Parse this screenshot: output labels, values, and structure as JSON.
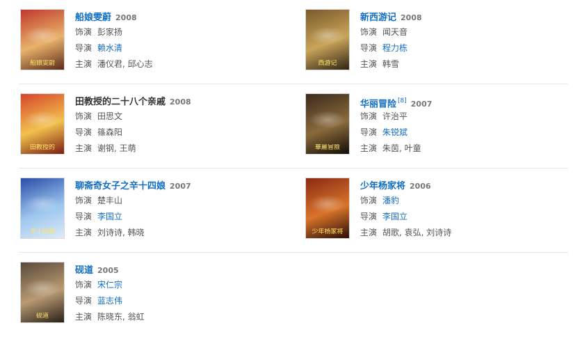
{
  "labels": {
    "role": "饰演",
    "director": "导演",
    "starring": "主演"
  },
  "films": [
    {
      "title": "船娘雯蔚",
      "year": "2008",
      "role": "彭家扬",
      "director": "赖水清",
      "starring": "潘仪君, 邱心志",
      "poster_caption": "船娘雯蔚",
      "colors": [
        "#c0392b",
        "#e8b26a",
        "#5a2a1a"
      ]
    },
    {
      "title": "新西游记",
      "year": "2008",
      "role": "闻天音",
      "director": "程力栋",
      "starring": "韩雪",
      "poster_caption": "西游记",
      "colors": [
        "#7a5a2a",
        "#c9a45a",
        "#2e2313"
      ]
    },
    {
      "title": "田教授的二十八个亲戚",
      "year": "2008",
      "role": "田思文",
      "director": "篠森阳",
      "starring": "谢钢, 王萌",
      "poster_caption": "田教授的",
      "colors": [
        "#d6452a",
        "#f2c14e",
        "#7a1f12"
      ]
    },
    {
      "title": "华丽冒险",
      "sup": "[8]",
      "year": "2007",
      "role": "许治平",
      "director": "朱锐斌",
      "starring": "朱茵, 叶童",
      "poster_caption": "華麗冒險",
      "colors": [
        "#3a2a1c",
        "#8a6a3c",
        "#120c08"
      ]
    },
    {
      "title": "聊斋奇女子之辛十四娘",
      "year": "2007",
      "role": "楚丰山",
      "director": "李国立",
      "starring": "刘诗诗, 韩晓",
      "poster_caption": "辛十四娘",
      "colors": [
        "#2a4ea8",
        "#9cc6ef",
        "#dfeaf6"
      ]
    },
    {
      "title": "少年杨家将",
      "year": "2006",
      "role": "潘豹",
      "director": "李国立",
      "starring": "胡歌, 袁弘, 刘诗诗",
      "poster_caption": "少年杨家将",
      "colors": [
        "#8a2a14",
        "#d9742a",
        "#2a0e06"
      ]
    },
    {
      "title": "砚道",
      "year": "2005",
      "role": "宋仁宗",
      "director": "蓝志伟",
      "starring": "陈晓东, 翁虹",
      "poster_caption": "砚道",
      "colors": [
        "#5a4a3a",
        "#b89a72",
        "#2a2018"
      ]
    }
  ]
}
